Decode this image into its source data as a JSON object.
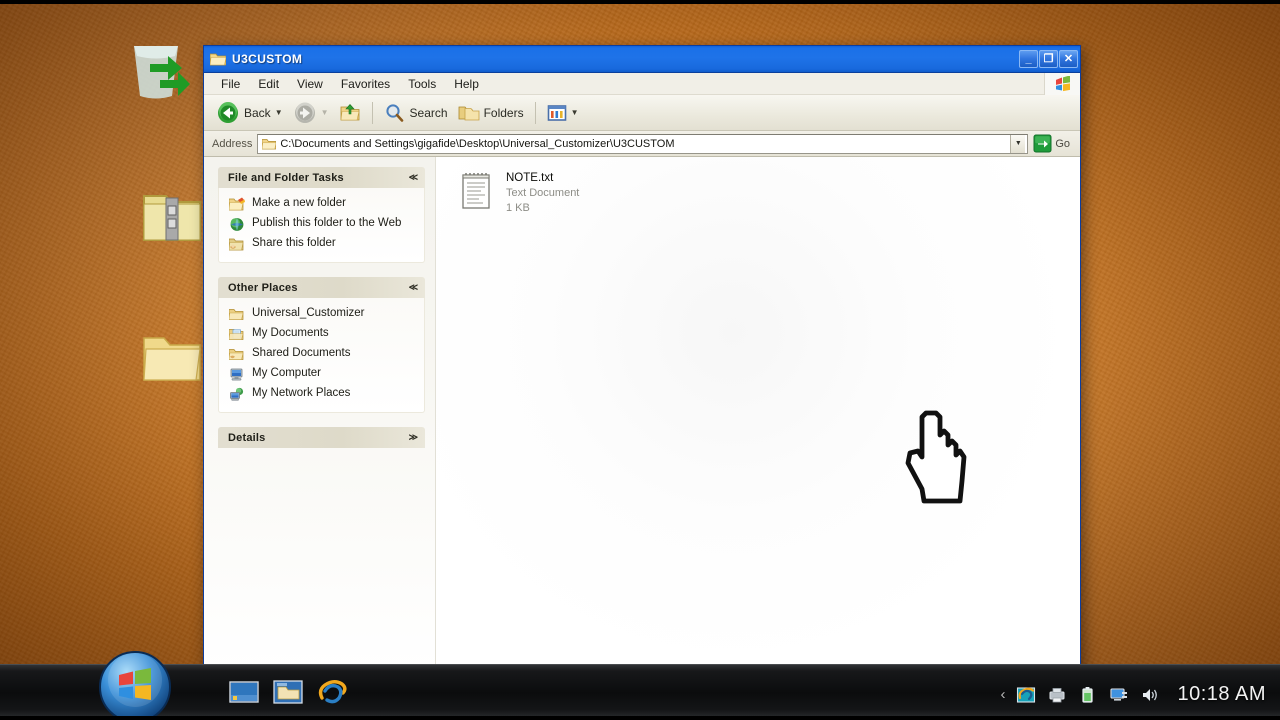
{
  "desktop": {
    "background_color": "#cf7a22",
    "icons": [
      {
        "name": "recycle-bin",
        "label": ""
      },
      {
        "name": "zip-folder",
        "label": ""
      },
      {
        "name": "folder",
        "label": ""
      }
    ]
  },
  "window": {
    "title": "U3CUSTOM",
    "title_bar_color": "#1f73e8",
    "controls": {
      "minimize": "_",
      "maximize": "❐",
      "close": "✕"
    },
    "menu": [
      {
        "label": "File"
      },
      {
        "label": "Edit"
      },
      {
        "label": "View"
      },
      {
        "label": "Favorites"
      },
      {
        "label": "Tools"
      },
      {
        "label": "Help"
      }
    ],
    "toolbar": {
      "back_label": "Back",
      "back_caret": "▼",
      "forward_caret": "▼",
      "search_label": "Search",
      "folders_label": "Folders",
      "views_caret": "▼"
    },
    "address": {
      "label": "Address",
      "value": "C:\\Documents and Settings\\gigafide\\Desktop\\Universal_Customizer\\U3CUSTOM",
      "dropdown_caret": "▼",
      "go_label": "Go"
    },
    "taskpane": {
      "panels": [
        {
          "title": "File and Folder Tasks",
          "chevron": "≪",
          "items": [
            {
              "icon": "new-folder-icon",
              "label": "Make a new folder"
            },
            {
              "icon": "globe-icon",
              "label": "Publish this folder to the Web"
            },
            {
              "icon": "share-folder-icon",
              "label": "Share this folder"
            }
          ]
        },
        {
          "title": "Other Places",
          "chevron": "≪",
          "items": [
            {
              "icon": "folder-icon",
              "label": "Universal_Customizer"
            },
            {
              "icon": "my-documents-icon",
              "label": "My Documents"
            },
            {
              "icon": "shared-documents-icon",
              "label": "Shared Documents"
            },
            {
              "icon": "my-computer-icon",
              "label": "My Computer"
            },
            {
              "icon": "network-places-icon",
              "label": "My Network Places"
            }
          ]
        },
        {
          "title": "Details",
          "chevron": "≫",
          "items": []
        }
      ]
    },
    "files": [
      {
        "name": "NOTE.txt",
        "type": "Text Document",
        "size": "1 KB",
        "icon": "text-document-icon"
      }
    ]
  },
  "taskbar": {
    "start_label": "",
    "quick_launch": [
      {
        "name": "show-desktop-icon"
      },
      {
        "name": "windows-explorer-icon"
      },
      {
        "name": "internet-explorer-icon"
      }
    ],
    "tray": {
      "expand_caret": "‹",
      "icons": [
        {
          "name": "ie-tray-icon"
        },
        {
          "name": "printer-tray-icon"
        },
        {
          "name": "battery-tray-icon"
        },
        {
          "name": "network-tray-icon"
        },
        {
          "name": "volume-tray-icon"
        }
      ],
      "clock": "10:18 AM"
    }
  }
}
